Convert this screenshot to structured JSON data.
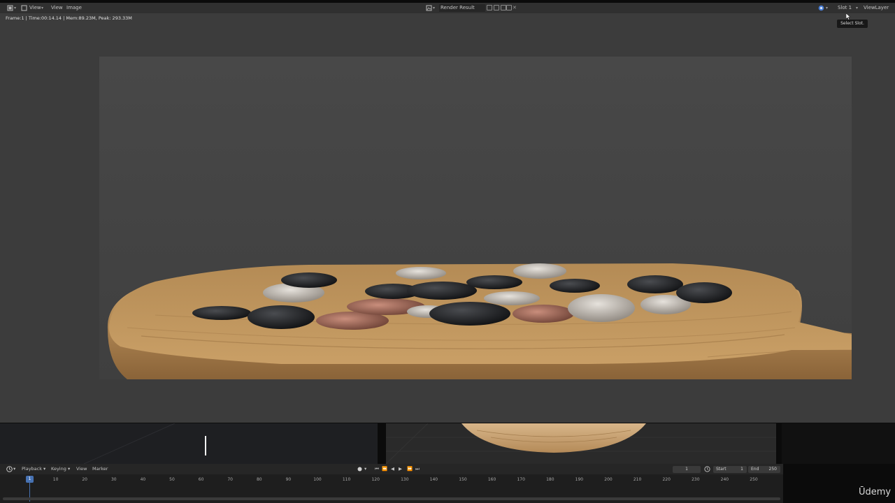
{
  "header": {
    "menu_view": "View",
    "menu_view2": "View",
    "menu_image": "Image",
    "image_name": "Render Result",
    "slot": "Slot 1",
    "view_layer": "ViewLayer"
  },
  "editor": {
    "info": "Frame:1 | Time:00:14.14 | Mem:89.23M, Peak: 293.33M",
    "tooltip": "Select Slot."
  },
  "timeline": {
    "playback": "Playback",
    "keying": "Keying",
    "view": "View",
    "marker": "Marker",
    "current_frame": "1",
    "start_label": "Start",
    "start_value": "1",
    "end_label": "End",
    "end_value": "250",
    "ruler_ticks": [
      "10",
      "20",
      "30",
      "40",
      "50",
      "60",
      "70",
      "80",
      "90",
      "100",
      "110",
      "120",
      "130",
      "140",
      "150",
      "160",
      "170",
      "180",
      "190",
      "200",
      "210",
      "220",
      "230",
      "240",
      "250"
    ],
    "marker_frame": "1"
  },
  "watermark": "Ūdemy",
  "colors": {
    "accent": "#4772b3",
    "header_bg": "#303030",
    "editor_bg": "#3c3c3c",
    "render_bg": "#474747"
  }
}
